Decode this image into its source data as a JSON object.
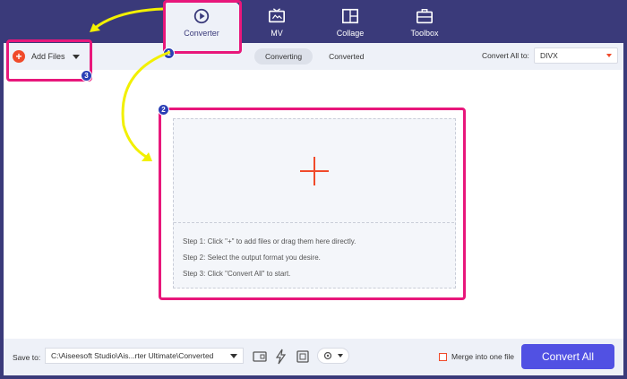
{
  "nav": {
    "tabs": [
      {
        "label": "Converter",
        "icon": "converter-icon",
        "active": true
      },
      {
        "label": "MV",
        "icon": "tv-icon",
        "active": false
      },
      {
        "label": "Collage",
        "icon": "collage-icon",
        "active": false
      },
      {
        "label": "Toolbox",
        "icon": "toolbox-icon",
        "active": false
      }
    ]
  },
  "toolbar": {
    "add_files_label": "Add Files",
    "segments": [
      "Converting",
      "Converted"
    ],
    "active_segment": "Converting",
    "convert_all_to_label": "Convert All to:",
    "format_value": "DIVX"
  },
  "dropzone": {
    "steps": [
      "Step 1: Click \"+\" to add files or drag them here directly.",
      "Step 2: Select the output format you desire.",
      "Step 3: Click \"Convert All\" to start."
    ]
  },
  "bottom": {
    "save_to_label": "Save to:",
    "save_path": "C:\\Aiseesoft Studio\\Ais...rter Ultimate\\Converted",
    "merge_label": "Merge into one file",
    "merge_checked": false,
    "convert_all_label": "Convert All"
  },
  "annotations": {
    "badges": [
      "1",
      "2",
      "3"
    ],
    "highlight_color": "#e8177b",
    "arrow_color": "#f2f000",
    "badge_color": "#2b3fb5"
  },
  "colors": {
    "header_bg": "#3a3a7a",
    "accent_orange": "#f04a2a",
    "convert_button": "#5151e3"
  }
}
